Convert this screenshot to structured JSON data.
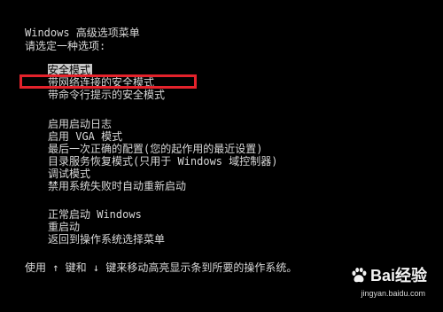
{
  "header": {
    "title": "Windows 高级选项菜单",
    "prompt": "请选定一种选项:"
  },
  "menu": {
    "group1": [
      "安全模式",
      "带网络连接的安全模式",
      "带命令行提示的安全模式"
    ],
    "group2": [
      "启用启动日志",
      "启用 VGA 模式",
      "最后一次正确的配置(您的起作用的最近设置)",
      "目录服务恢复模式(只用于 Windows 域控制器)",
      "调试模式",
      "禁用系统失败时自动重新启动"
    ],
    "group3": [
      "正常启动 Windows",
      "重启动",
      "返回到操作系统选择菜单"
    ]
  },
  "footer": {
    "hint": "使用 ↑ 键和 ↓ 键来移动高亮显示条到所要的操作系统。"
  },
  "watermark": {
    "brand": "Bai经验",
    "url": "jingyan.baidu.com"
  },
  "colors": {
    "background": "#000000",
    "text": "#d8d8d8",
    "selection": "#c8c8c8",
    "annotation": "#e3222b"
  }
}
